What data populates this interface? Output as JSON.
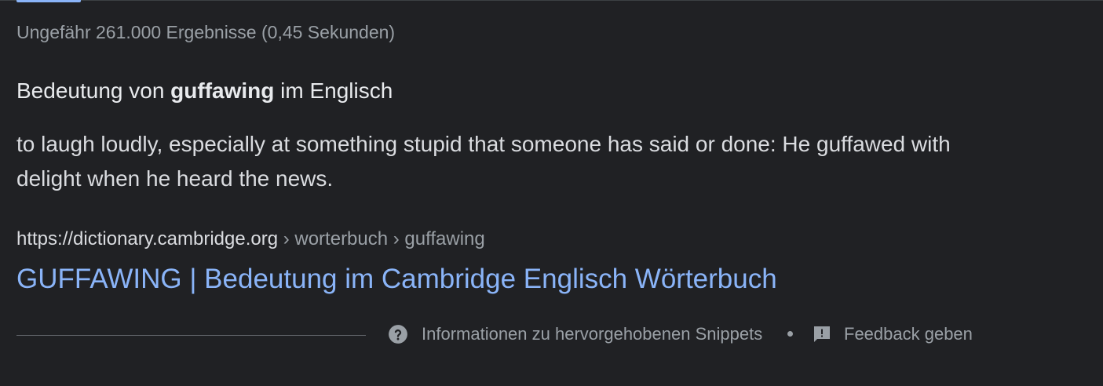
{
  "result_stats": "Ungefähr 261.000 Ergebnisse (0,45 Sekunden)",
  "snippet": {
    "heading_prefix": "Bedeutung von ",
    "heading_term": "guffawing",
    "heading_suffix": " im Englisch",
    "definition": "to laugh loudly, especially at something stupid that someone has said or done: He guffawed with delight when he heard the news."
  },
  "source": {
    "domain": "https://dictionary.cambridge.org",
    "path": " › worterbuch › guffawing",
    "title": "GUFFAWING | Bedeutung im Cambridge Englisch Wörterbuch"
  },
  "footer": {
    "info_label": "Informationen zu hervorgehobenen Snippets",
    "info_icon": "help-circle-icon",
    "feedback_label": "Feedback geben",
    "feedback_icon": "feedback-icon"
  },
  "colors": {
    "background": "#202124",
    "link": "#8ab4f8",
    "text": "#dadce0",
    "muted": "#9aa0a6"
  }
}
